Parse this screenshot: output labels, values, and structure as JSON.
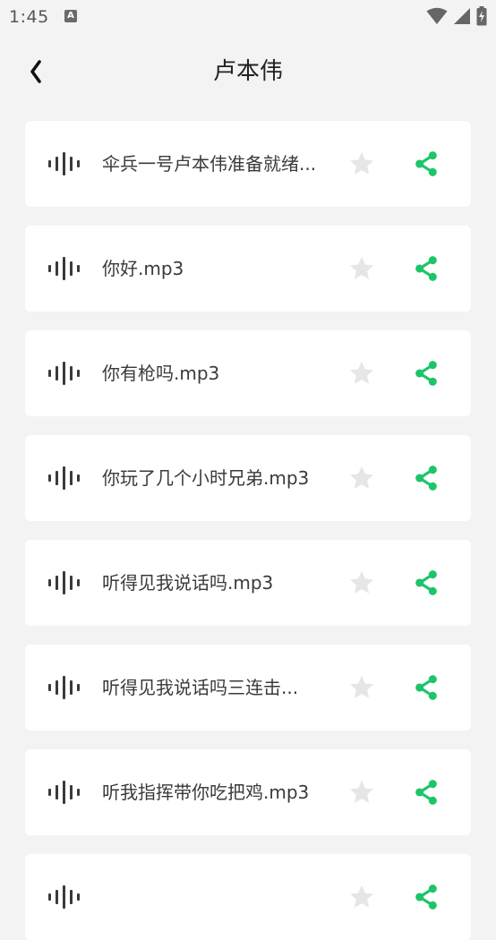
{
  "status_bar": {
    "time": "1:45",
    "app_icon_letter": "A",
    "icons": [
      "wifi-icon",
      "cellular-signal-icon",
      "battery-charging-icon"
    ]
  },
  "header": {
    "title": "卢本伟",
    "back_icon": "chevron-left-icon"
  },
  "colors": {
    "accent": "#1ec46a",
    "star": "#e6e6e6",
    "wave": "#3a3a3a",
    "background": "#f3f3f3",
    "card": "#ffffff"
  },
  "items": [
    {
      "name": "伞兵一号卢本伟准备就绪..."
    },
    {
      "name": "你好.mp3"
    },
    {
      "name": "你有枪吗.mp3"
    },
    {
      "name": "你玩了几个小时兄弟.mp3"
    },
    {
      "name": "听得见我说话吗.mp3"
    },
    {
      "name": "听得见我说话吗三连击..."
    },
    {
      "name": "听我指挥带你吃把鸡.mp3"
    },
    {
      "name": ""
    }
  ]
}
